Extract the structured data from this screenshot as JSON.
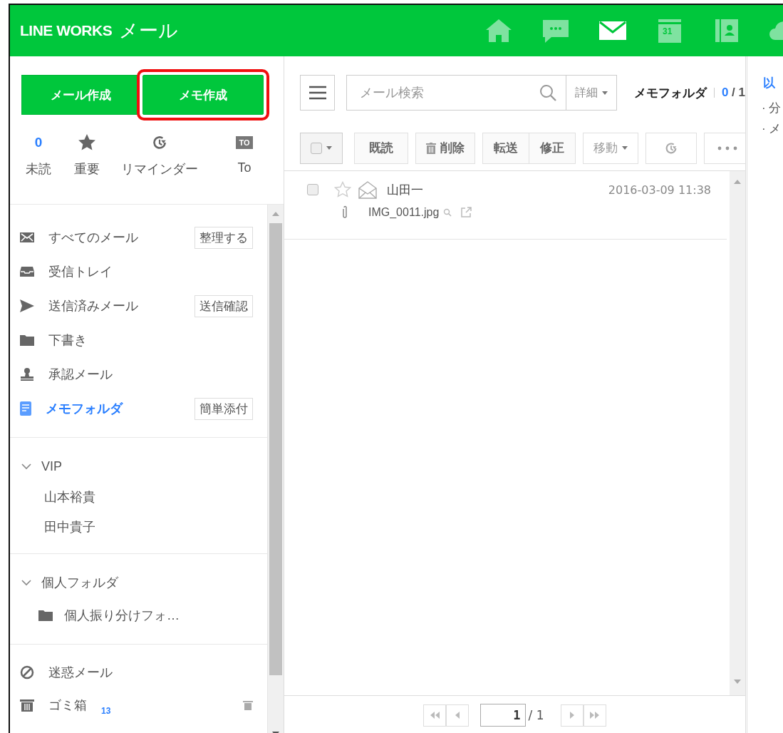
{
  "header": {
    "logo": "LINE WORKS",
    "app_name": "メール",
    "nav": [
      {
        "kind": "home",
        "selected": false
      },
      {
        "kind": "chat",
        "selected": false
      },
      {
        "kind": "mail",
        "selected": true
      },
      {
        "kind": "calendar",
        "label": "31",
        "selected": false
      },
      {
        "kind": "contacts",
        "selected": false
      },
      {
        "kind": "drive",
        "selected": false
      }
    ]
  },
  "sidebar": {
    "compose_buttons": [
      {
        "label": "メール作成",
        "highlighted": false
      },
      {
        "label": "メモ作成",
        "highlighted": true
      }
    ],
    "quick_filters": [
      {
        "kind": "count",
        "value": "0",
        "label": "未読"
      },
      {
        "kind": "star",
        "label": "重要"
      },
      {
        "kind": "reminder",
        "label": "リマインダー"
      },
      {
        "kind": "to",
        "badge": "TO",
        "label": "To"
      }
    ],
    "folders": [
      {
        "kind": "all",
        "label": "すべてのメール",
        "action": "整理する",
        "selected": false
      },
      {
        "kind": "inbox",
        "label": "受信トレイ",
        "selected": false
      },
      {
        "kind": "sent",
        "label": "送信済みメール",
        "action": "送信確認",
        "selected": false
      },
      {
        "kind": "drafts",
        "label": "下書き",
        "selected": false
      },
      {
        "kind": "approval",
        "label": "承認メール",
        "selected": false
      },
      {
        "kind": "memo",
        "label": "メモフォルダ",
        "action": "簡単添付",
        "selected": true
      }
    ],
    "vip": {
      "title": "VIP",
      "expanded": true,
      "items": [
        "山本裕貴",
        "田中貴子"
      ]
    },
    "personal": {
      "title": "個人フォルダ",
      "expanded": true,
      "items": [
        "個人振り分けフォ…"
      ]
    },
    "other": [
      {
        "kind": "spam",
        "label": "迷惑メール"
      },
      {
        "kind": "trash",
        "label": "ゴミ箱",
        "count": "13"
      }
    ]
  },
  "mail": {
    "search": {
      "placeholder": "メール検索",
      "detail": "詳細"
    },
    "folder_title": "メモフォルダ",
    "unread": "0",
    "separator": "/",
    "total": "1",
    "actions": [
      {
        "kind": "select"
      },
      {
        "kind": "text",
        "label": "既読"
      },
      {
        "kind": "trash",
        "label": "削除"
      },
      {
        "kind": "pair",
        "labels": [
          "転送",
          "修正"
        ]
      },
      {
        "kind": "dropdown",
        "label": "移動"
      },
      {
        "kind": "reminder"
      },
      {
        "kind": "more"
      }
    ],
    "messages": [
      {
        "checked": false,
        "starred": false,
        "sender": "山田一",
        "date": "2016-03-09 11:38",
        "attachment": "IMG_0011.jpg"
      }
    ],
    "pagination": {
      "page": "1",
      "total": "/ 1"
    }
  },
  "preview": {
    "lines": [
      {
        "kind": "heading",
        "text": "以"
      },
      {
        "kind": "bullet",
        "text": "· 分"
      },
      {
        "kind": "bullet",
        "text": "· メ"
      }
    ]
  }
}
